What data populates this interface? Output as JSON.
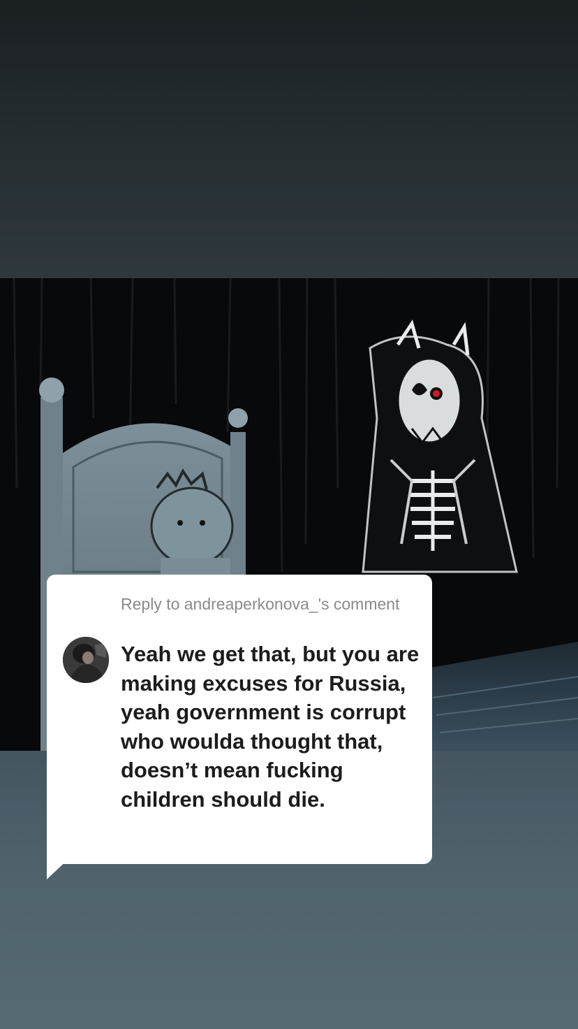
{
  "reply": {
    "header": "Reply to andreaperkonova_'s comment",
    "body": "Yeah we get that, but you are making excuses for Russia, yeah government is corrupt who woulda thought that, doesn’t mean fucking children should die.",
    "avatar": "user-avatar"
  },
  "video": {
    "content": "illustration-bed-and-skeletal-figure"
  },
  "colors": {
    "bubble": "#ffffff",
    "header_text": "#8a8a8a",
    "body_text": "#1c1c1c",
    "eye_red": "#d0182a"
  }
}
